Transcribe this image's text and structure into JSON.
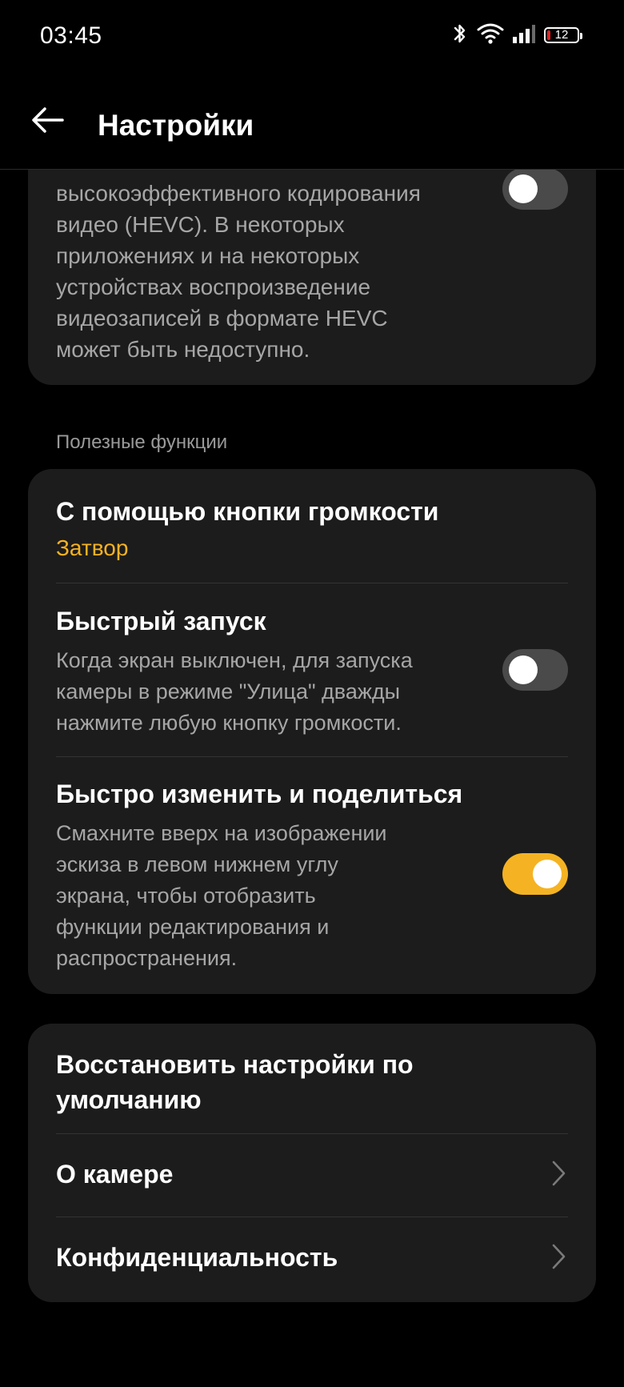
{
  "status_bar": {
    "time": "03:45",
    "battery_level": "12",
    "battery_fraction": 0.12,
    "battery_color": "#e02424"
  },
  "app_bar": {
    "title": "Настройки",
    "back_icon": "arrow-left-icon"
  },
  "hevc": {
    "description": "высокоэффективного кодирования\nвидео (HEVC). В некоторых\nприложениях и на некоторых\nустройствах воспроизведение\nвидеозаписей в формате HEVC\nможет быть недоступно.",
    "enabled": false
  },
  "useful": {
    "section_label": "Полезные функции",
    "volume": {
      "title": "С помощью кнопки громкости",
      "value": "Затвор"
    },
    "quick_launch": {
      "title": "Быстрый запуск",
      "description": "Когда экран выключен, для запуска\nкамеры в режиме \"Улица\" дважды\nнажмите любую кнопку громкости.",
      "enabled": false
    },
    "quick_edit": {
      "title": "Быстро изменить и поделиться",
      "description": "Смахните вверх на изображении\nэскиза в левом нижнем углу\nэкрана, чтобы отобразить\nфункции редактирования и\nраспространения.",
      "enabled": true
    }
  },
  "bottom": {
    "reset": "Восстановить настройки по умолчанию",
    "about": "О камере",
    "privacy": "Конфиденциальность"
  },
  "colors": {
    "accent": "#f5b323",
    "background": "#000000",
    "card": "#1c1c1c"
  }
}
